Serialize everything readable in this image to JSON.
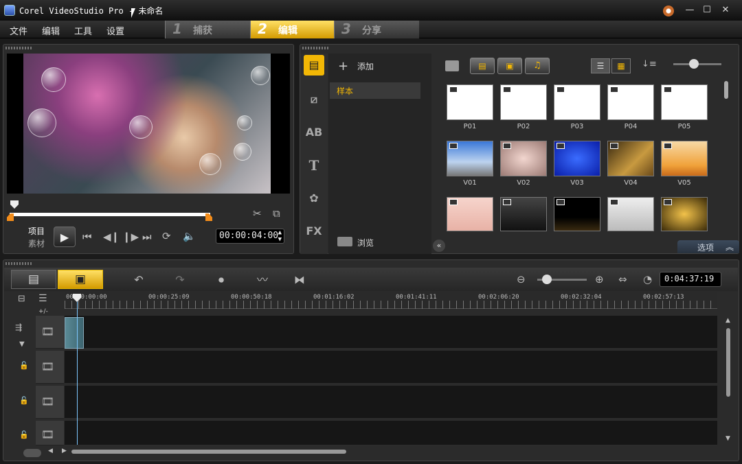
{
  "window": {
    "title": "Corel VideoStudio Pro - 未命名"
  },
  "menu": {
    "file": "文件",
    "edit": "编辑",
    "tools": "工具",
    "settings": "设置"
  },
  "steps": [
    {
      "num": "1",
      "label": "捕获"
    },
    {
      "num": "2",
      "label": "编辑"
    },
    {
      "num": "3",
      "label": "分享"
    }
  ],
  "player": {
    "mode_project": "项目",
    "mode_clip": "素材",
    "timecode": "00:00:04:00"
  },
  "library": {
    "add_label": "添加",
    "folder": "样本",
    "browse_label": "浏览",
    "options_label": "选项",
    "rows": [
      [
        "P01",
        "P02",
        "P03",
        "P04",
        "P05"
      ],
      [
        "V01",
        "V02",
        "V03",
        "V04",
        "V05"
      ],
      [
        "",
        "",
        "",
        "",
        ""
      ]
    ]
  },
  "timeline": {
    "duration": "0:04:37:19",
    "track_add_label": "+/-",
    "ruler": [
      "00:00:00:00",
      "00:00:25:09",
      "00:00:50:18",
      "00:01:16:02",
      "00:01:41:11",
      "00:02:06:20",
      "00:02:32:04",
      "00:02:57:13"
    ]
  },
  "colors": {
    "accent": "#f2b705",
    "playhead": "#7ec8ff"
  }
}
